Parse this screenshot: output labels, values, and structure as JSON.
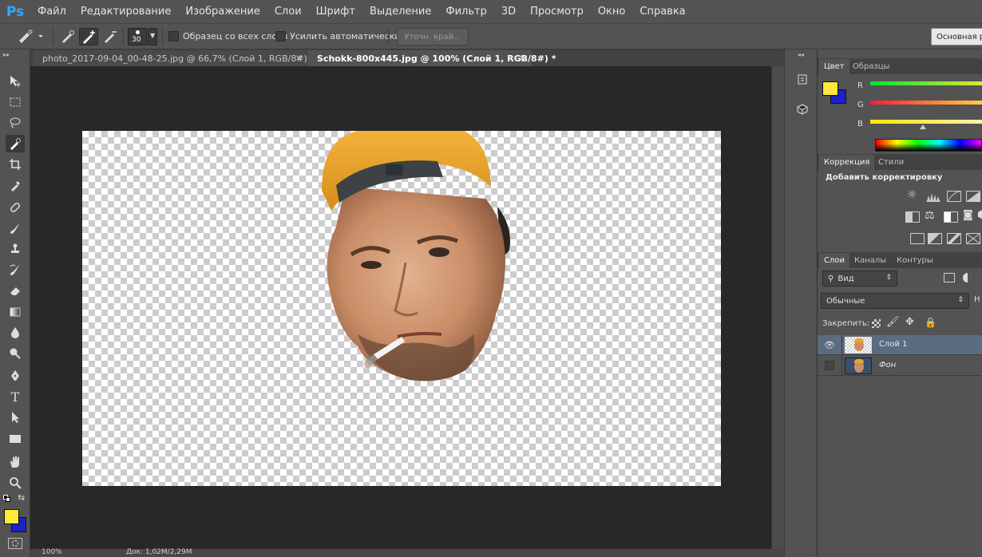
{
  "app": {
    "logo": "Ps"
  },
  "menu": [
    "Файл",
    "Редактирование",
    "Изображение",
    "Слои",
    "Шрифт",
    "Выделение",
    "Фильтр",
    "3D",
    "Просмотр",
    "Окно",
    "Справка"
  ],
  "options": {
    "brush_size": "30",
    "sample_all_layers_label": "Образец со всех слоев",
    "auto_enhance_label": "Усилить автоматически",
    "refine_edge_label": "Уточн. край...",
    "workspace_label": "Основная ра"
  },
  "tabs": [
    {
      "label": "photo_2017-09-04_00-48-25.jpg @ 66,7% (Слой 1, RGB/8#) *",
      "close": "×"
    },
    {
      "label": "Schokk-800x445.jpg @ 100% (Слой 1, RGB/8#) *",
      "close": "×"
    }
  ],
  "status": {
    "zoom": "100%",
    "doc_info": "Док: 1,02М/2,29М"
  },
  "color_panel": {
    "tabs": [
      "Цвет",
      "Образцы"
    ],
    "channels": [
      "R",
      "G",
      "B"
    ],
    "foreground": "#ffe93b",
    "background": "#1d21c8"
  },
  "adjustments_panel": {
    "tabs": [
      "Коррекция",
      "Стили"
    ],
    "title": "Добавить корректировку"
  },
  "layers_panel": {
    "tabs": [
      "Слои",
      "Каналы",
      "Контуры"
    ],
    "filter_label": "Вид",
    "blend_mode": "Обычные",
    "opacity_prefix": "Н",
    "lock_label": "Закрепить:",
    "layers": [
      {
        "name": "Слой 1",
        "selected": true,
        "visible": true
      },
      {
        "name": "Фон",
        "selected": false,
        "visible": false
      }
    ]
  }
}
